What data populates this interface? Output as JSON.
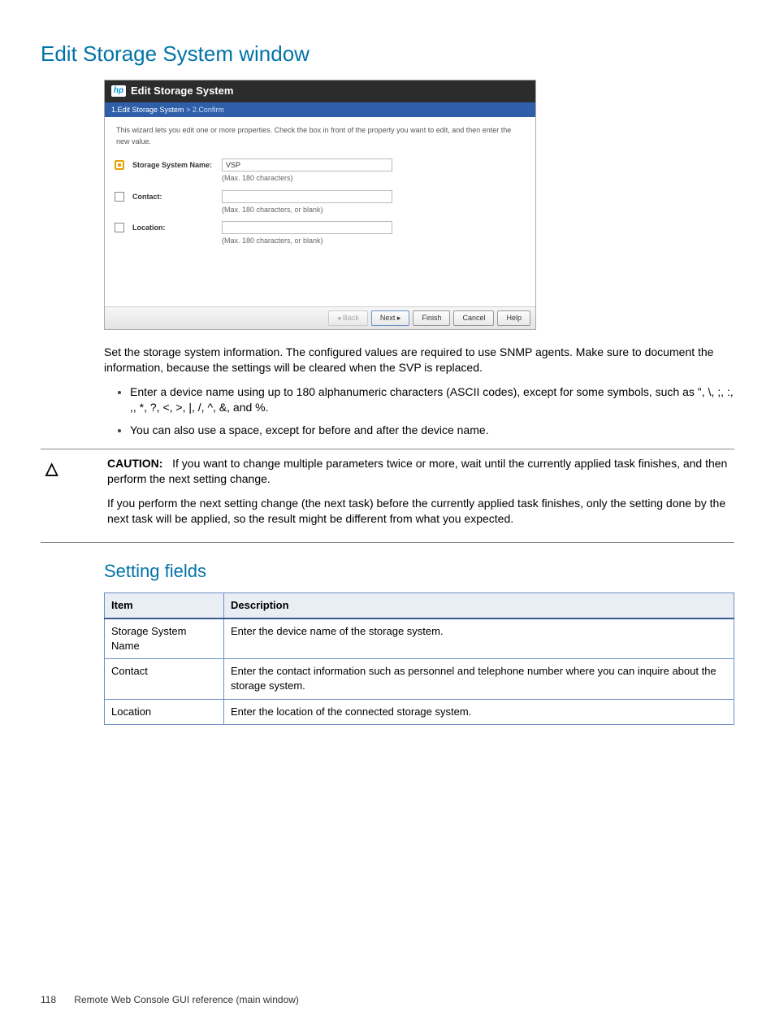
{
  "page": {
    "title": "Edit Storage System window",
    "subsection": "Setting fields",
    "footer_page": "118",
    "footer_text": "Remote Web Console GUI reference (main window)"
  },
  "dialog": {
    "title": "Edit Storage System",
    "crumb_step1": "1.Edit Storage System",
    "crumb_sep": ">",
    "crumb_step2": "2.Confirm",
    "desc": "This wizard lets you edit one or more properties. Check the box in front of the property you want to edit, and then enter the new value.",
    "fields": [
      {
        "label": "Storage System Name:",
        "value": "VSP",
        "hint": "(Max. 180 characters)",
        "checked": true
      },
      {
        "label": "Contact:",
        "value": "",
        "hint": "(Max. 180 characters, or blank)",
        "checked": false
      },
      {
        "label": "Location:",
        "value": "",
        "hint": "(Max. 180 characters, or blank)",
        "checked": false
      }
    ],
    "buttons": {
      "back": "◂ Back",
      "next": "Next ▸",
      "finish": "Finish",
      "cancel": "Cancel",
      "help": "Help"
    }
  },
  "body": {
    "p1": "Set the storage system information. The configured values are required to use SNMP agents. Make sure to document the information, because the settings will be cleared when the SVP is replaced.",
    "bullets": [
      "Enter a device name using up to 180 alphanumeric characters (ASCII codes), except for some symbols, such as \", \\, ;, :, ,, *, ?, <, >, |, /, ^, &, and %.",
      "You can also use a space, except for before and after the device name."
    ]
  },
  "caution": {
    "label": "CAUTION:",
    "p1": "If you want to change multiple parameters twice or more, wait until the currently applied task finishes, and then perform the next setting change.",
    "p2": "If you perform the next setting change (the next task) before the currently applied task finishes, only the setting done by the next task will be applied, so the result might be different from what you expected."
  },
  "table": {
    "head_item": "Item",
    "head_desc": "Description",
    "rows": [
      {
        "item": "Storage System Name",
        "desc": "Enter the device name of the storage system."
      },
      {
        "item": "Contact",
        "desc": "Enter the contact information such as personnel and telephone number where you can inquire about the storage system."
      },
      {
        "item": "Location",
        "desc": "Enter the location of the connected storage system."
      }
    ]
  }
}
